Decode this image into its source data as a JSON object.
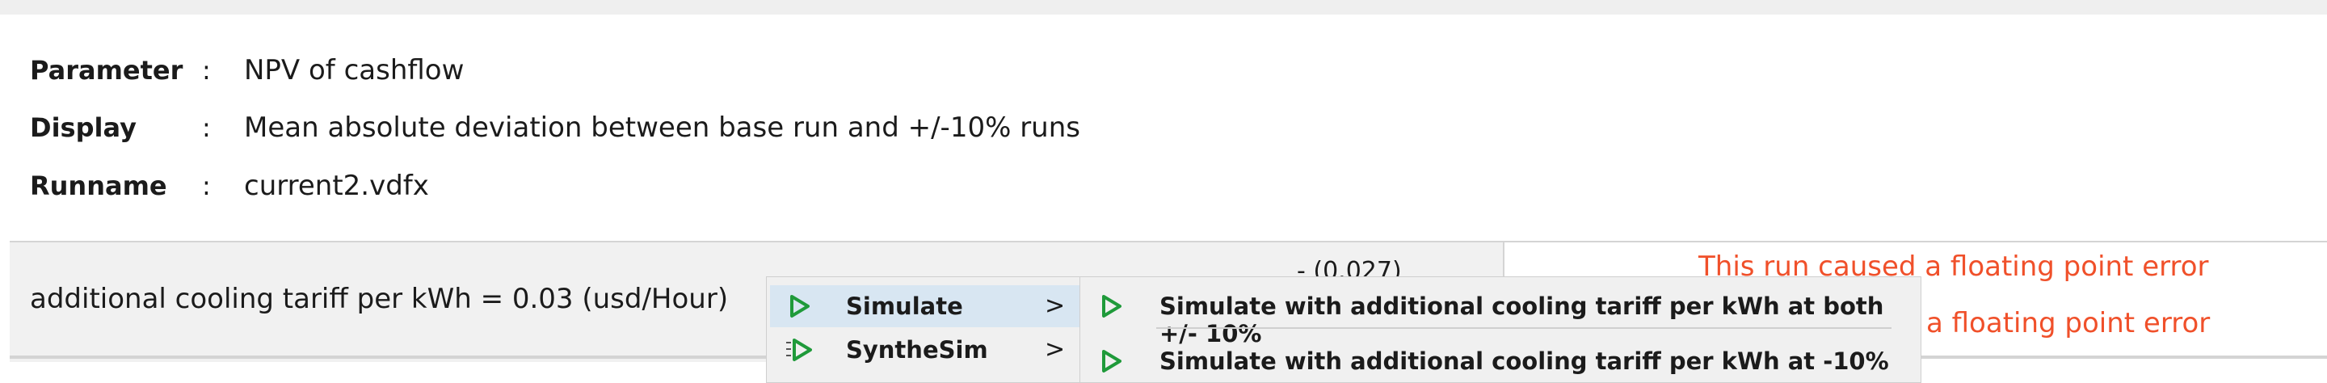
{
  "info": {
    "parameter_label": "Parameter",
    "parameter_value": "NPV of cashflow",
    "display_label": "Display",
    "display_value": "Mean absolute deviation between base run and +/-10% runs",
    "runname_label": "Runname",
    "runname_value": "current2.vdfx",
    "colon": ":"
  },
  "row": {
    "label": "additional cooling tariff per kWh = 0.03 (usd/Hour)",
    "deviation": "- (0.027)",
    "errors": [
      "This run caused a floating point error",
      "a floating point error"
    ]
  },
  "context_menu": {
    "items": [
      {
        "label": "Simulate",
        "icon": "play-icon",
        "chevron": ">"
      },
      {
        "label": "SyntheSim",
        "icon": "synthesim-icon",
        "chevron": ">"
      }
    ],
    "submenu": [
      {
        "label": "Simulate with additional cooling tariff per kWh at both +/- 10%",
        "icon": "play-icon"
      },
      {
        "label": "Simulate with additional cooling tariff per kWh at -10%",
        "icon": "play-icon"
      }
    ]
  },
  "colors": {
    "error_text": "#f0502a",
    "play_icon_stroke": "#1f9a3a",
    "highlight": "#d8e6f2"
  }
}
